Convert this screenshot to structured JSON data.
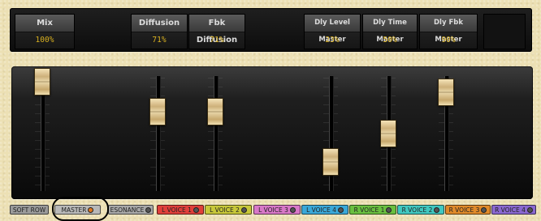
{
  "params": [
    {
      "label": "Mix",
      "value": "100%"
    },
    {
      "label": "Diffusion",
      "value": "71%"
    },
    {
      "label": "Fbk Diffusion",
      "value": "71%"
    },
    {
      "label": "Dly Level Master",
      "value": "23%"
    },
    {
      "label": "Dly Time Master",
      "value": "50%"
    },
    {
      "label": "Dly Fbk Master",
      "value": "90%"
    }
  ],
  "faders": [
    {
      "name": "mix",
      "level": 1.0
    },
    {
      "name": "diffusion",
      "level": 0.71
    },
    {
      "name": "fbk-diffusion",
      "level": 0.71
    },
    {
      "name": "dly-level-master",
      "level": 0.23
    },
    {
      "name": "dly-time-master",
      "level": 0.5
    },
    {
      "name": "dly-fbk-master",
      "level": 0.9
    }
  ],
  "tabs": [
    {
      "label": "SOFT ROW",
      "color": "#9a9a9a"
    },
    {
      "label": "MASTER",
      "color": "#b8b8b8"
    },
    {
      "label": "ESONANCE",
      "color": "#a8a8a8"
    },
    {
      "label": "L VOICE 1",
      "color": "#e0403a"
    },
    {
      "label": "L VOICE 2",
      "color": "#c8c83a"
    },
    {
      "label": "L VOICE 3",
      "color": "#d878c8"
    },
    {
      "label": "L VOICE 4",
      "color": "#3aa8d8"
    },
    {
      "label": "R VOICE 1",
      "color": "#6ac040"
    },
    {
      "label": "R VOICE 2",
      "color": "#40c8c0"
    },
    {
      "label": "R VOICE 3",
      "color": "#e08a2a"
    },
    {
      "label": "R VOICE 4",
      "color": "#8a68d0"
    }
  ]
}
